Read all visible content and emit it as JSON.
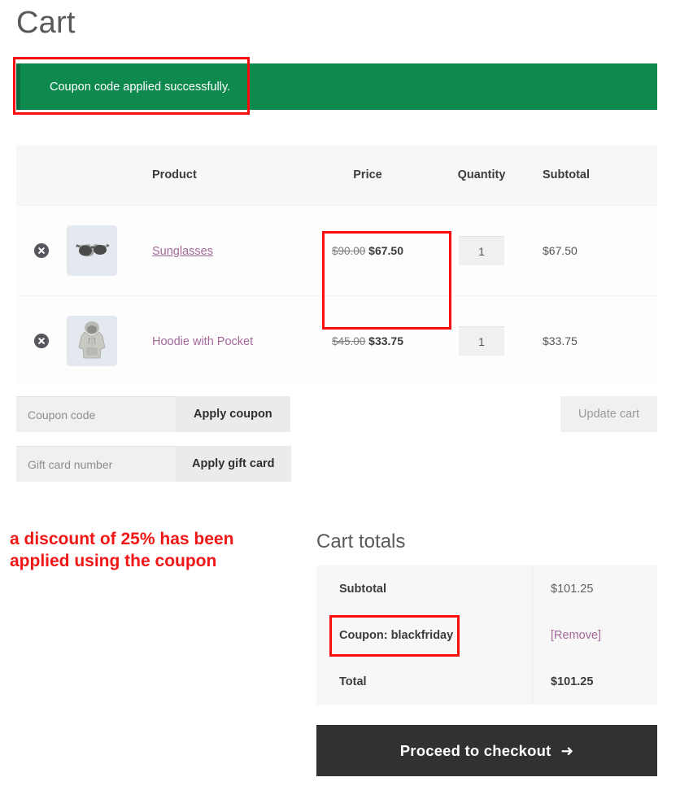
{
  "page": {
    "title": "Cart"
  },
  "notice": {
    "message": "Coupon code applied successfully.",
    "background_color": "#0f8a4f",
    "accent_color": "#0b6e3f"
  },
  "cart_table": {
    "headers": {
      "remove": "",
      "thumbnail": "",
      "product": "Product",
      "price": "Price",
      "quantity": "Quantity",
      "subtotal": "Subtotal"
    },
    "rows": [
      {
        "remove_icon": "remove-circle-x-icon",
        "thumbnail_icon": "sunglasses-thumbnail",
        "name": "Sunglasses",
        "name_underlined": true,
        "price_original": "$90.00",
        "price_discounted": "$67.50",
        "quantity": "1",
        "subtotal": "$67.50"
      },
      {
        "remove_icon": "remove-circle-x-icon",
        "thumbnail_icon": "hoodie-thumbnail",
        "name": "Hoodie with Pocket",
        "name_underlined": false,
        "price_original": "$45.00",
        "price_discounted": "$33.75",
        "quantity": "1",
        "subtotal": "$33.75"
      }
    ]
  },
  "coupon_form": {
    "coupon_input_placeholder": "Coupon code",
    "coupon_input_value": "",
    "apply_coupon_label": "Apply coupon",
    "gift_input_placeholder": "Gift card number",
    "gift_input_value": "",
    "apply_gift_label": "Apply gift card",
    "update_cart_label": "Update cart"
  },
  "annotation": {
    "line1": "a discount of 25% has been",
    "line2": "applied using the coupon",
    "color": "#f01616"
  },
  "cart_totals": {
    "title": "Cart totals",
    "rows": [
      {
        "label": "Subtotal",
        "value": "$101.25",
        "bold_value": false,
        "is_link": false
      },
      {
        "label": "Coupon: blackfriday",
        "value": "[Remove]",
        "bold_value": false,
        "is_link": true
      },
      {
        "label": "Total",
        "value": "$101.25",
        "bold_value": true,
        "is_link": false
      }
    ]
  },
  "checkout": {
    "label": "Proceed to checkout",
    "arrow": "➜",
    "background_color": "#33312f"
  },
  "highlights": {
    "color": "#fb0d0d",
    "boxes": [
      "notice-banner",
      "price-column",
      "coupon-total-row"
    ]
  }
}
